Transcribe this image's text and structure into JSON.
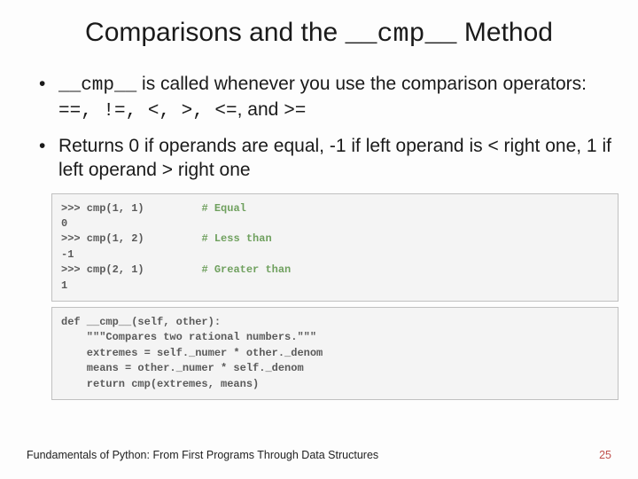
{
  "title": {
    "part1": "Comparisons and the ",
    "code": "__cmp__",
    "part2": " Method"
  },
  "bullets": {
    "b1_code": "__cmp__",
    "b1_text1": " is called whenever you use the comparison operators: ",
    "b1_ops": "==, !=, <, >, <=",
    "b1_and": ", and ",
    "b1_lastop": ">=",
    "b2": "Returns 0 if operands are equal, -1 if left operand is < right one, 1 if left operand > right one"
  },
  "code1": {
    "l1a": ">>> cmp(1, 1)",
    "l1c": "# Equal",
    "l2": "0",
    "l3a": ">>> cmp(1, 2)",
    "l3c": "# Less than",
    "l4": "-1",
    "l5a": ">>> cmp(2, 1)",
    "l5c": "# Greater than",
    "l6": "1"
  },
  "code2": {
    "l1": "def __cmp__(self, other):",
    "l2": "    \"\"\"Compares two rational numbers.\"\"\"",
    "l3": "    extremes = self._numer * other._denom",
    "l4": "    means = other._numer * self._denom",
    "l5": "    return cmp(extremes, means)"
  },
  "footer": {
    "text": "Fundamentals of Python: From First Programs Through Data Structures",
    "page": "25"
  }
}
